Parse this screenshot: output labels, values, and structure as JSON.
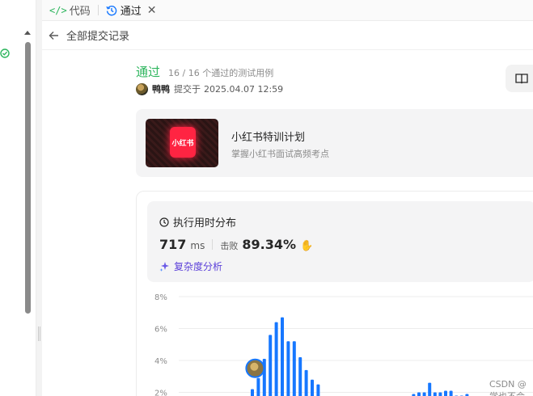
{
  "tabs": {
    "code_icon": "</>",
    "code_label": "代码",
    "pass_label": "通过",
    "close_glyph": "✕"
  },
  "subheader": {
    "back_label": "全部提交记录"
  },
  "submission": {
    "status": "通过",
    "detail": "16 / 16 个通过的测试用例",
    "user": "鸭鸭",
    "submitted_prefix": "提交于",
    "submitted_time": "2025.04.07 12:59",
    "status_color": "#2db55d"
  },
  "promo": {
    "logo_text": "小红书",
    "title": "小红书特训计划",
    "subtitle": "掌握小红书面试高频考点"
  },
  "stats": {
    "title": "执行用时分布",
    "runtime_value": "717",
    "runtime_unit": "ms",
    "beat_label": "击败",
    "beat_value": "89.34%",
    "complexity_label": "复杂度分析"
  },
  "chart_data": {
    "type": "bar",
    "y_ticks": [
      "8%",
      "6%",
      "4%",
      "2%"
    ],
    "ylim": [
      0,
      8
    ],
    "grid": true,
    "values": [
      2.2,
      2.9,
      4.1,
      5.6,
      6.4,
      6.7,
      5.2,
      5.2,
      4.2,
      3.4,
      2.8,
      2.5,
      1.2,
      1.0,
      0.9,
      0.9,
      0.9,
      0.8,
      0.8,
      0.8,
      0.8,
      0.8,
      0.8,
      1.9,
      2.0,
      2.0,
      2.6,
      2.0,
      2.0,
      2.1,
      2.1,
      1.8,
      1.8,
      1.9
    ],
    "highlight_index": 1,
    "bar_color": "#1677ff"
  },
  "watermark": "CSDN @学也不会"
}
